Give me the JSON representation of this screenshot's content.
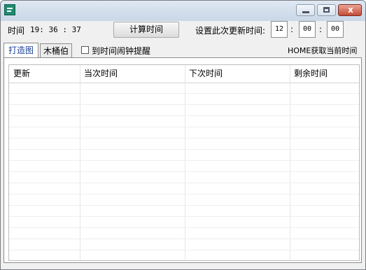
{
  "titlebar": {
    "icon": "app-icon",
    "buttons": [
      "minimize-icon",
      "maximize-icon",
      "close-icon"
    ],
    "close_glyph": "x"
  },
  "header": {
    "time_label": "时间",
    "time_value": "19: 36 : 37",
    "calc_button": "计算时间",
    "set_label": "设置此次更新时间:",
    "hour": "12",
    "minute": "00",
    "second": "00",
    "colon": ":"
  },
  "tabs": [
    {
      "label": "打造图"
    },
    {
      "label": "木桶伯"
    }
  ],
  "options": {
    "alarm_label": "到时间闹钟提醒",
    "home_label": "HOME获取当前时间"
  },
  "table": {
    "columns": [
      "更新",
      "当次时间",
      "下次时间",
      "剩余时间"
    ],
    "row_count": 15,
    "rows": []
  },
  "colors": {
    "window_bg": "#f0f0f0",
    "panel_bg": "#ffffff",
    "tab_active_text": "#1a3f9a"
  }
}
